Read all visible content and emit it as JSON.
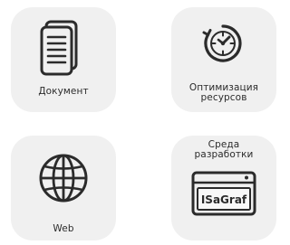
{
  "tiles": [
    {
      "label": "Документ",
      "icon": "document-icon"
    },
    {
      "label": "Оптимизация\nресурсов",
      "icon": "clock-optimization-icon"
    },
    {
      "label": "Web",
      "icon": "globe-icon"
    },
    {
      "label": "Среда\nразработки",
      "icon": "isagraf-window-icon",
      "icon_text": "ISaGraf"
    }
  ],
  "colors": {
    "tile_bg": "#f0f0f0",
    "icon_stroke": "#2b2b2b",
    "text": "#2b2b2b"
  }
}
